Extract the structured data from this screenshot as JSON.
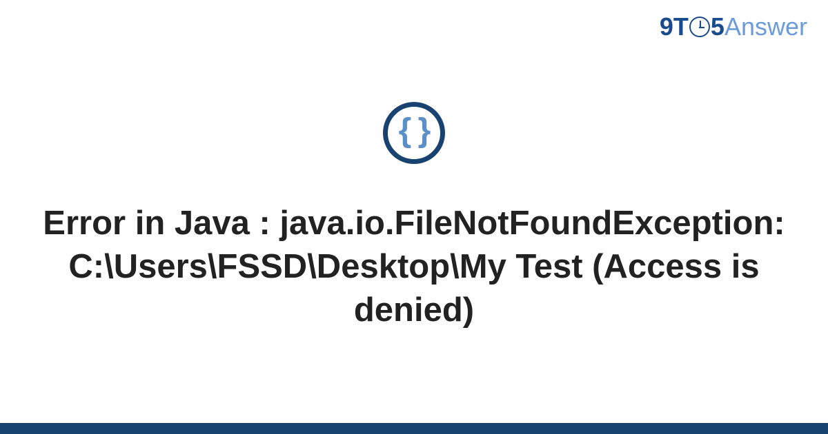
{
  "brand": {
    "part1": "9T",
    "part2": "5",
    "part3": "Answer"
  },
  "badge": {
    "glyph": "{ }"
  },
  "title": "Error in Java : java.io.FileNotFoundException: C:\\Users\\FSSD\\Desktop\\My Test (Access is denied)"
}
